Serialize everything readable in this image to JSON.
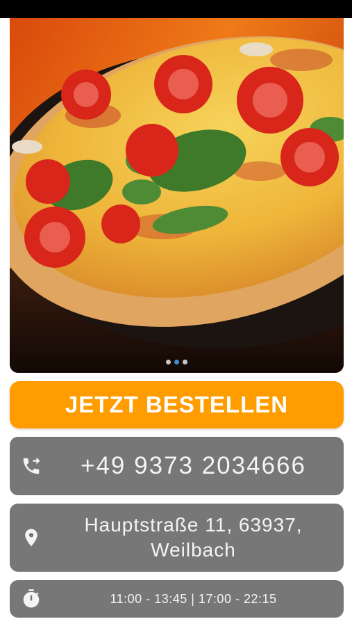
{
  "hero": {
    "image": "pizza-photo",
    "carousel": {
      "count": 3,
      "active_index": 1
    }
  },
  "order_button": {
    "label": "JETZT BESTELLEN",
    "color": "#ff9c00"
  },
  "phone": {
    "icon": "phone-forward-icon",
    "number": "+49 9373 2034666"
  },
  "address": {
    "icon": "location-pin-icon",
    "line1": "Hauptstraße 11, 63937,",
    "line2": "Weilbach"
  },
  "hours": {
    "icon": "stopwatch-icon",
    "text": "11:00 - 13:45 | 17:00 - 22:15"
  },
  "colors": {
    "card_bg": "#777777",
    "card_text": "#f4f4f4",
    "accent": "#ff9c00",
    "active_dot": "#3b8fd8"
  }
}
